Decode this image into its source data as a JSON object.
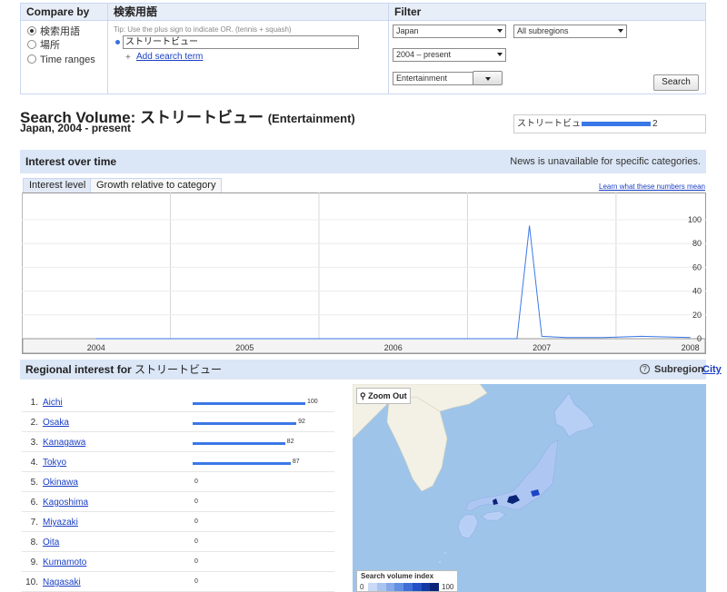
{
  "query_panel": {
    "compare_by": {
      "heading": "Compare by",
      "options": [
        {
          "label": "検索用語",
          "selected": true
        },
        {
          "label": "場所",
          "selected": false
        },
        {
          "label": "Time ranges",
          "selected": false
        }
      ]
    },
    "terms": {
      "heading": "検索用語",
      "tip": "Tip: Use the plus sign to indicate OR. (tennis + squash)",
      "term_value": "ストリートビュー",
      "add_link": "Add search term"
    },
    "filter": {
      "heading": "Filter",
      "location": "Japan",
      "subregion": "All subregions",
      "time_range": "2004 – present",
      "category": "Entertainment",
      "search_button": "Search"
    }
  },
  "title": {
    "main": "Search Volume: ストリートビュー",
    "category": "(Entertainment)",
    "subtitle": "Japan, 2004 - present"
  },
  "legend": {
    "term": "ストリートビュー",
    "value": "2",
    "color": "#3b78e7"
  },
  "interest_over_time": {
    "heading": "Interest over time",
    "note": "News is unavailable for specific categories.",
    "tabs": [
      "Interest level",
      "Growth relative to category"
    ],
    "learn_link": "Learn what these numbers mean"
  },
  "chart_data": {
    "type": "line",
    "x": [
      "2004-01",
      "2004-07",
      "2005-01",
      "2005-07",
      "2006-01",
      "2006-07",
      "2006-10",
      "2006-11",
      "2006-12",
      "2007-01",
      "2007-03",
      "2007-06",
      "2007-09",
      "2008-01"
    ],
    "series": [
      {
        "values": [
          0,
          0,
          0,
          0,
          0,
          0,
          0,
          0,
          95,
          2,
          1,
          1,
          2,
          1
        ]
      }
    ],
    "x_tick_labels": [
      "2004",
      "2005",
      "2006",
      "2007",
      "2008"
    ],
    "y_tick_labels": [
      "100",
      "80",
      "60",
      "40",
      "20",
      "0"
    ],
    "ylim": [
      0,
      100
    ],
    "grid": true,
    "line_color": "#3b78e7"
  },
  "regional": {
    "heading": "Regional interest",
    "for_label": "for",
    "term": "ストリートビュー",
    "help_icon": "help-icon",
    "subregion_label": "Subregion",
    "subregion_link": "City",
    "rows": [
      {
        "rank": "1.",
        "name": "Aichi",
        "value": 100
      },
      {
        "rank": "2.",
        "name": "Osaka",
        "value": 92
      },
      {
        "rank": "3.",
        "name": "Kanagawa",
        "value": 82
      },
      {
        "rank": "4.",
        "name": "Tokyo",
        "value": 87
      },
      {
        "rank": "5.",
        "name": "Okinawa",
        "value": 0
      },
      {
        "rank": "6.",
        "name": "Kagoshima",
        "value": 0
      },
      {
        "rank": "7.",
        "name": "Miyazaki",
        "value": 0
      },
      {
        "rank": "8.",
        "name": "Oita",
        "value": 0
      },
      {
        "rank": "9.",
        "name": "Kumamoto",
        "value": 0
      },
      {
        "rank": "10.",
        "name": "Nagasaki",
        "value": 0
      }
    ]
  },
  "map": {
    "zoom_out": "Zoom Out",
    "index_title": "Search volume index",
    "index_min": "0",
    "index_max": "100",
    "scale_colors": [
      "#c9d9f6",
      "#a9c3f0",
      "#86a9ea",
      "#6390e2",
      "#416fd8",
      "#2451c4",
      "#123aa5",
      "#0a2577"
    ]
  }
}
